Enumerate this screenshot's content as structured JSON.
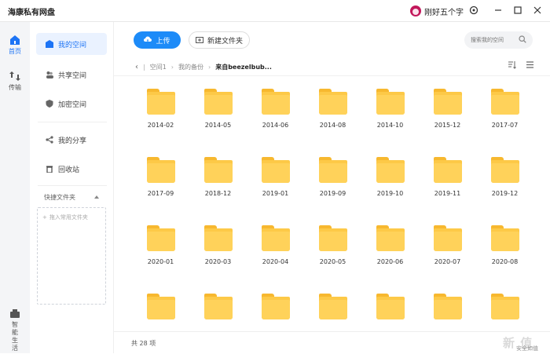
{
  "app": {
    "title": "海康私有网盘"
  },
  "user": {
    "name": "刚好五个字"
  },
  "rail": {
    "items": [
      {
        "label": "首页"
      },
      {
        "label": "传输"
      },
      {
        "label": "智能生活"
      }
    ]
  },
  "nav": {
    "items": [
      {
        "label": "我的空间"
      },
      {
        "label": "共享空间"
      },
      {
        "label": "加密空间"
      },
      {
        "label": "我的分享"
      },
      {
        "label": "回收站"
      }
    ],
    "quick_label": "快捷文件夹",
    "quick_hint": "拖入常用文件夹"
  },
  "toolbar": {
    "upload_label": "上传",
    "new_folder_label": "新建文件夹"
  },
  "search": {
    "placeholder": "搜索我的空间"
  },
  "breadcrumb": {
    "items": [
      "空间1",
      "我的备份",
      "来自beezelbub..."
    ]
  },
  "folders": [
    "2014-02",
    "2014-05",
    "2014-06",
    "2014-08",
    "2014-10",
    "2015-12",
    "2017-07",
    "2017-09",
    "2018-12",
    "2019-01",
    "2019-09",
    "2019-10",
    "2019-11",
    "2019-12",
    "2020-01",
    "2020-03",
    "2020-04",
    "2020-05",
    "2020-06",
    "2020-07",
    "2020-08",
    "",
    "",
    "",
    "",
    "",
    "",
    ""
  ],
  "footer": {
    "count_text": "共 28 项"
  },
  "watermark": {
    "logo": "新 值",
    "sub": "安全如值"
  },
  "colors": {
    "accent": "#1d8bf8",
    "folder": "#ffd25a",
    "active_bg": "#eaf2ff"
  }
}
